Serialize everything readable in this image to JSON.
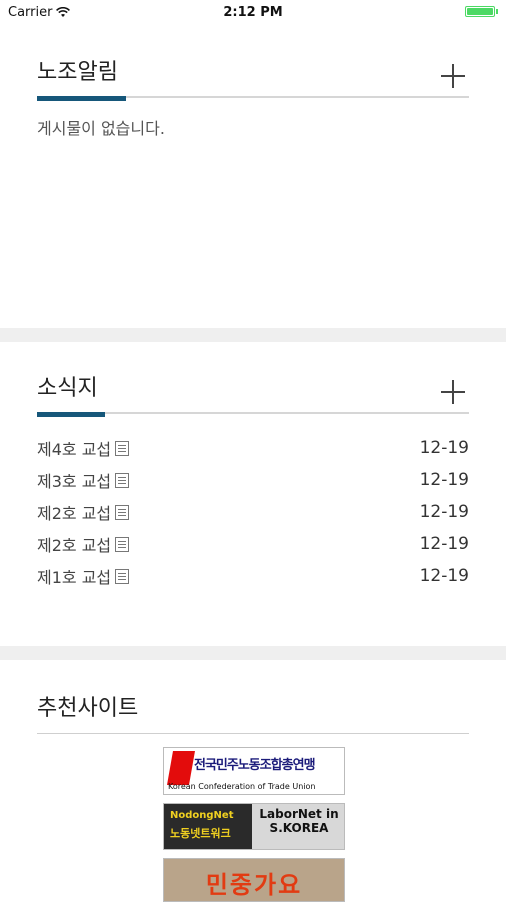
{
  "status_bar": {
    "carrier": "Carrier",
    "time": "2:12 PM"
  },
  "notices": {
    "title": "노조알림",
    "empty_text": "게시물이 없습니다."
  },
  "newsletter": {
    "title": "소식지",
    "items": [
      {
        "label": "제4호 교섭",
        "date": "12-19"
      },
      {
        "label": "제3호 교섭",
        "date": "12-19"
      },
      {
        "label": "제2호 교섭",
        "date": "12-19"
      },
      {
        "label": "제2호 교섭",
        "date": "12-19"
      },
      {
        "label": "제1호 교섭",
        "date": "12-19"
      }
    ]
  },
  "recommended": {
    "title": "추천사이트",
    "banners": [
      {
        "line1": "전국민주노동조합총연맹",
        "line2": "Korean Confederation of Trade Union"
      },
      {
        "left1": "NodongNet",
        "left2": "노동넷트워크",
        "right": "LaborNet in S.KOREA"
      },
      {
        "text": "민중가요"
      }
    ]
  },
  "colors": {
    "accent": "#16577a",
    "divider": "#efefef",
    "battery": "#4cd964"
  }
}
